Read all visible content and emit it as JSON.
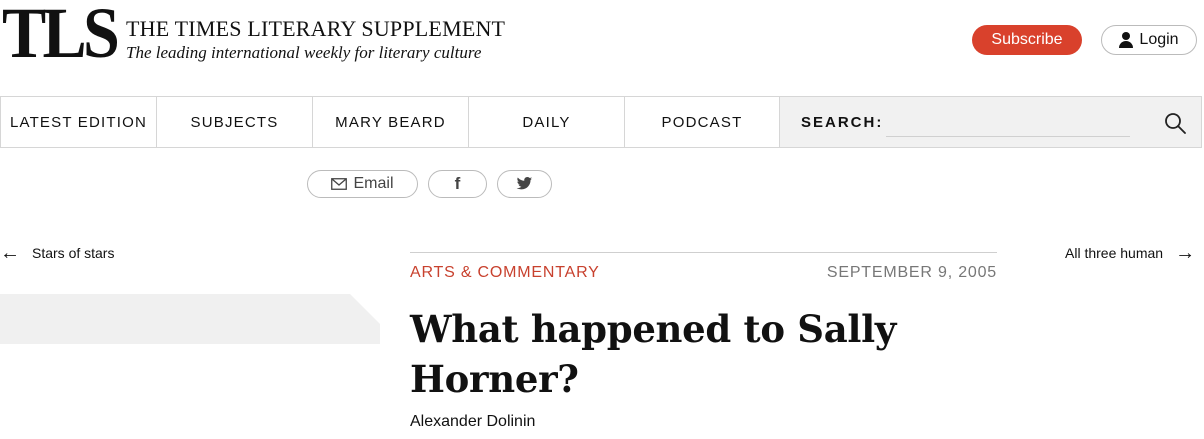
{
  "header": {
    "logo": "TLS",
    "title": "THE TIMES LITERARY SUPPLEMENT",
    "tagline": "The leading international weekly for literary culture",
    "subscribe_label": "Subscribe",
    "login_label": "Login"
  },
  "nav": {
    "items": [
      {
        "label": "LATEST EDITION"
      },
      {
        "label": "SUBJECTS"
      },
      {
        "label": "MARY BEARD"
      },
      {
        "label": "DAILY"
      },
      {
        "label": "PODCAST"
      }
    ],
    "search_label": "SEARCH:",
    "search_value": "",
    "search_placeholder": ""
  },
  "share": {
    "email_label": "Email",
    "facebook_icon": "f",
    "twitter_icon": "twitter-bird"
  },
  "article_nav": {
    "prev_label": "Stars of stars",
    "next_label": "All three human"
  },
  "article": {
    "category": "ARTS & COMMENTARY",
    "date": "SEPTEMBER 9, 2005",
    "headline": "What happened to Sally Horner?",
    "author": "Alexander Dolinin"
  },
  "colors": {
    "accent": "#d9412c",
    "category": "#c8412e"
  }
}
